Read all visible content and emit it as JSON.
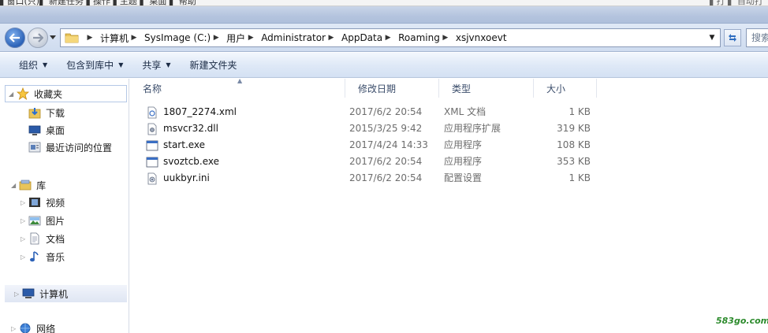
{
  "background_window": {
    "left_text": "▌窗口(只)▌ 新建任务 ▌操作 ▌主题 ▌ 桌面 ▌ 帮助",
    "right_text": "▌打 ▌ 自动打"
  },
  "address_bar": {
    "crumbs": [
      "计算机",
      "SysImage (C:)",
      "用户",
      "Administrator",
      "AppData",
      "Roaming",
      "xsjvnxoevt"
    ]
  },
  "search": {
    "placeholder": "搜索"
  },
  "toolbar": {
    "organize": "组织",
    "include_in_library": "包含到库中",
    "share": "共享",
    "new_folder": "新建文件夹"
  },
  "navigation": {
    "favorites": "收藏夹",
    "downloads": "下载",
    "desktop": "桌面",
    "recent": "最近访问的位置",
    "libraries": "库",
    "videos": "视频",
    "pictures": "图片",
    "documents": "文档",
    "music": "音乐",
    "computer": "计算机",
    "network": "网络"
  },
  "columns": {
    "name": "名称",
    "date": "修改日期",
    "type": "类型",
    "size": "大小"
  },
  "files": [
    {
      "name": "1807_2274.xml",
      "date": "2017/6/2 20:54",
      "type": "XML 文档",
      "size": "1 KB",
      "icon": "xml-file-icon"
    },
    {
      "name": "msvcr32.dll",
      "date": "2015/3/25 9:42",
      "type": "应用程序扩展",
      "size": "319 KB",
      "icon": "dll-file-icon"
    },
    {
      "name": "start.exe",
      "date": "2017/4/24 14:33",
      "type": "应用程序",
      "size": "108 KB",
      "icon": "exe-file-icon"
    },
    {
      "name": "svoztcb.exe",
      "date": "2017/6/2 20:54",
      "type": "应用程序",
      "size": "353 KB",
      "icon": "exe-file-icon"
    },
    {
      "name": "uukbyr.ini",
      "date": "2017/6/2 20:54",
      "type": "配置设置",
      "size": "1 KB",
      "icon": "ini-file-icon"
    }
  ],
  "watermark": "583go.com"
}
